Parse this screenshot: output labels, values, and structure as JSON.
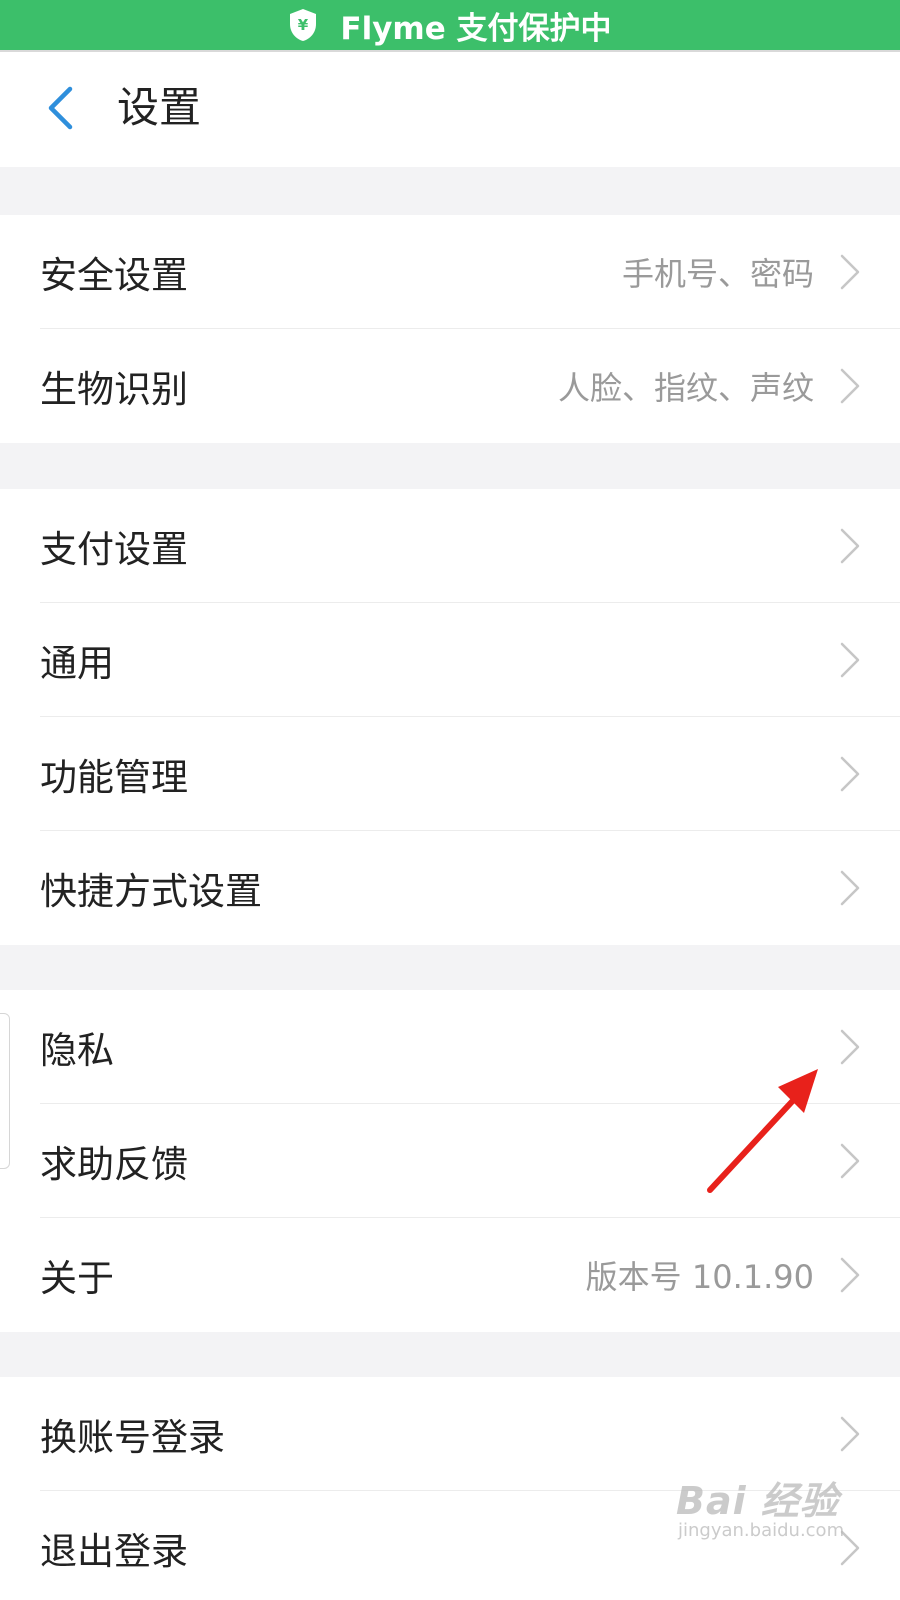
{
  "pay_banner": {
    "icon": "shield-yen-icon",
    "text": "Flyme 支付保护中",
    "color": "#3cbf6a"
  },
  "header": {
    "title": "设置",
    "back_icon": "chevron-left-icon",
    "accent": "#2f8fdc"
  },
  "groups": [
    {
      "rows": [
        {
          "label": "安全设置",
          "value": "手机号、密码"
        },
        {
          "label": "生物识别",
          "value": "人脸、指纹、声纹"
        }
      ]
    },
    {
      "rows": [
        {
          "label": "支付设置",
          "value": ""
        },
        {
          "label": "通用",
          "value": ""
        },
        {
          "label": "功能管理",
          "value": ""
        },
        {
          "label": "快捷方式设置",
          "value": ""
        }
      ]
    },
    {
      "rows": [
        {
          "label": "隐私",
          "value": ""
        },
        {
          "label": "求助反馈",
          "value": ""
        },
        {
          "label": "关于",
          "value": "版本号 10.1.90"
        }
      ]
    },
    {
      "rows": [
        {
          "label": "换账号登录",
          "value": ""
        },
        {
          "label": "退出登录",
          "value": ""
        }
      ]
    }
  ],
  "annotation": {
    "icon": "red-arrow-icon",
    "color": "#e8211b"
  },
  "watermark": {
    "main": "Bai 经验",
    "sub": "jingyan.baidu.com"
  }
}
